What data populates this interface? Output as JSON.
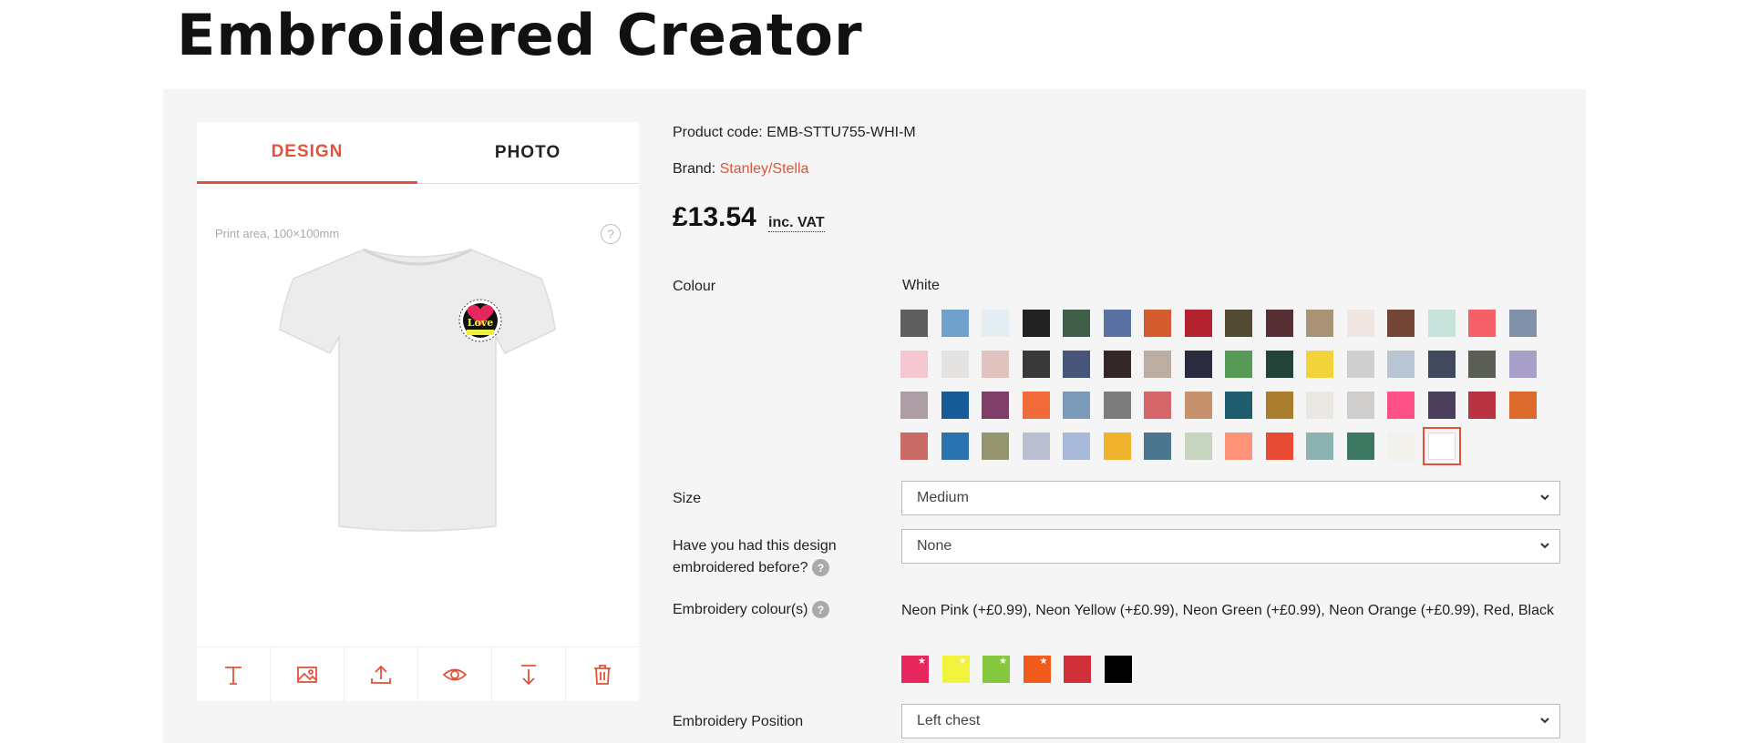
{
  "page": {
    "title": "Embroidered Creator"
  },
  "tabs": [
    {
      "label": "DESIGN",
      "active": true
    },
    {
      "label": "PHOTO",
      "active": false
    }
  ],
  "preview": {
    "print_area": "Print area, 100×100mm",
    "help": "?",
    "logo_text": "Love"
  },
  "tools": [
    "text-icon",
    "image-icon",
    "upload-icon",
    "eye-icon",
    "download-icon",
    "trash-icon"
  ],
  "product": {
    "code_label": "Product code:",
    "code": "EMB-STTU755-WHI-M",
    "brand_label": "Brand:",
    "brand": "Stanley/Stella",
    "price": "£13.54",
    "vat": "inc. VAT"
  },
  "colour": {
    "label": "Colour",
    "selected": "White",
    "swatches": [
      "#5f5f5f",
      "#6fa1cc",
      "#e4eef2",
      "#222222",
      "#3f5f48",
      "#5a71a4",
      "#d35d2e",
      "#b52330",
      "#524a33",
      "#562f35",
      "#a99376",
      "#f0e6e1",
      "#724535",
      "#c8e3dc",
      "#f56167",
      "#8191aa",
      "#f5c8d1",
      "#e4e1e1",
      "#e1c2bf",
      "#393939",
      "#475578",
      "#332626",
      "#bbada2",
      "#2b2b3f",
      "#589b58",
      "#234339",
      "#f2d43a",
      "#cfcfcf",
      "#b9c5d2",
      "#414a5d",
      "#5b5e54",
      "#a79fc8",
      "#ad9ea6",
      "#175c99",
      "#7e3e67",
      "#f06b39",
      "#7b9abb",
      "#7d7d7d",
      "#d5676a",
      "#c6916c",
      "#1f5c6e",
      "#ab7e2e",
      "#ebe7e3",
      "#d0cecc",
      "#fe5289",
      "#4c3f5b",
      "#b93343",
      "#dc6a2c",
      "#c96a66",
      "#2b73b0",
      "#959670",
      "#b9bfd1",
      "#a8b9d9",
      "#f2b32c",
      "#4c7690",
      "#c7d4c0",
      "#fe9379",
      "#e84b34",
      "#8cb2b1",
      "#3c7761",
      "#f2f1ec",
      "#ffffff"
    ]
  },
  "size": {
    "label": "Size",
    "value": "Medium"
  },
  "before": {
    "label_line1": "Have you had this design",
    "label_line2": "embroidered before?",
    "value": "None"
  },
  "embroidery": {
    "label": "Embroidery colour(s)",
    "text": "Neon Pink (+£0.99), Neon Yellow (+£0.99), Neon Green (+£0.99), Neon Orange (+£0.99), Red, Black",
    "swatches": [
      {
        "color": "#e8265e",
        "neon": true
      },
      {
        "color": "#f0f23c",
        "neon": true
      },
      {
        "color": "#85c83e",
        "neon": true
      },
      {
        "color": "#f05a1a",
        "neon": true
      },
      {
        "color": "#d0303a",
        "neon": false
      },
      {
        "color": "#000000",
        "neon": false
      }
    ]
  },
  "position": {
    "label": "Embroidery Position",
    "value": "Left chest"
  },
  "accent": "#e0533a"
}
